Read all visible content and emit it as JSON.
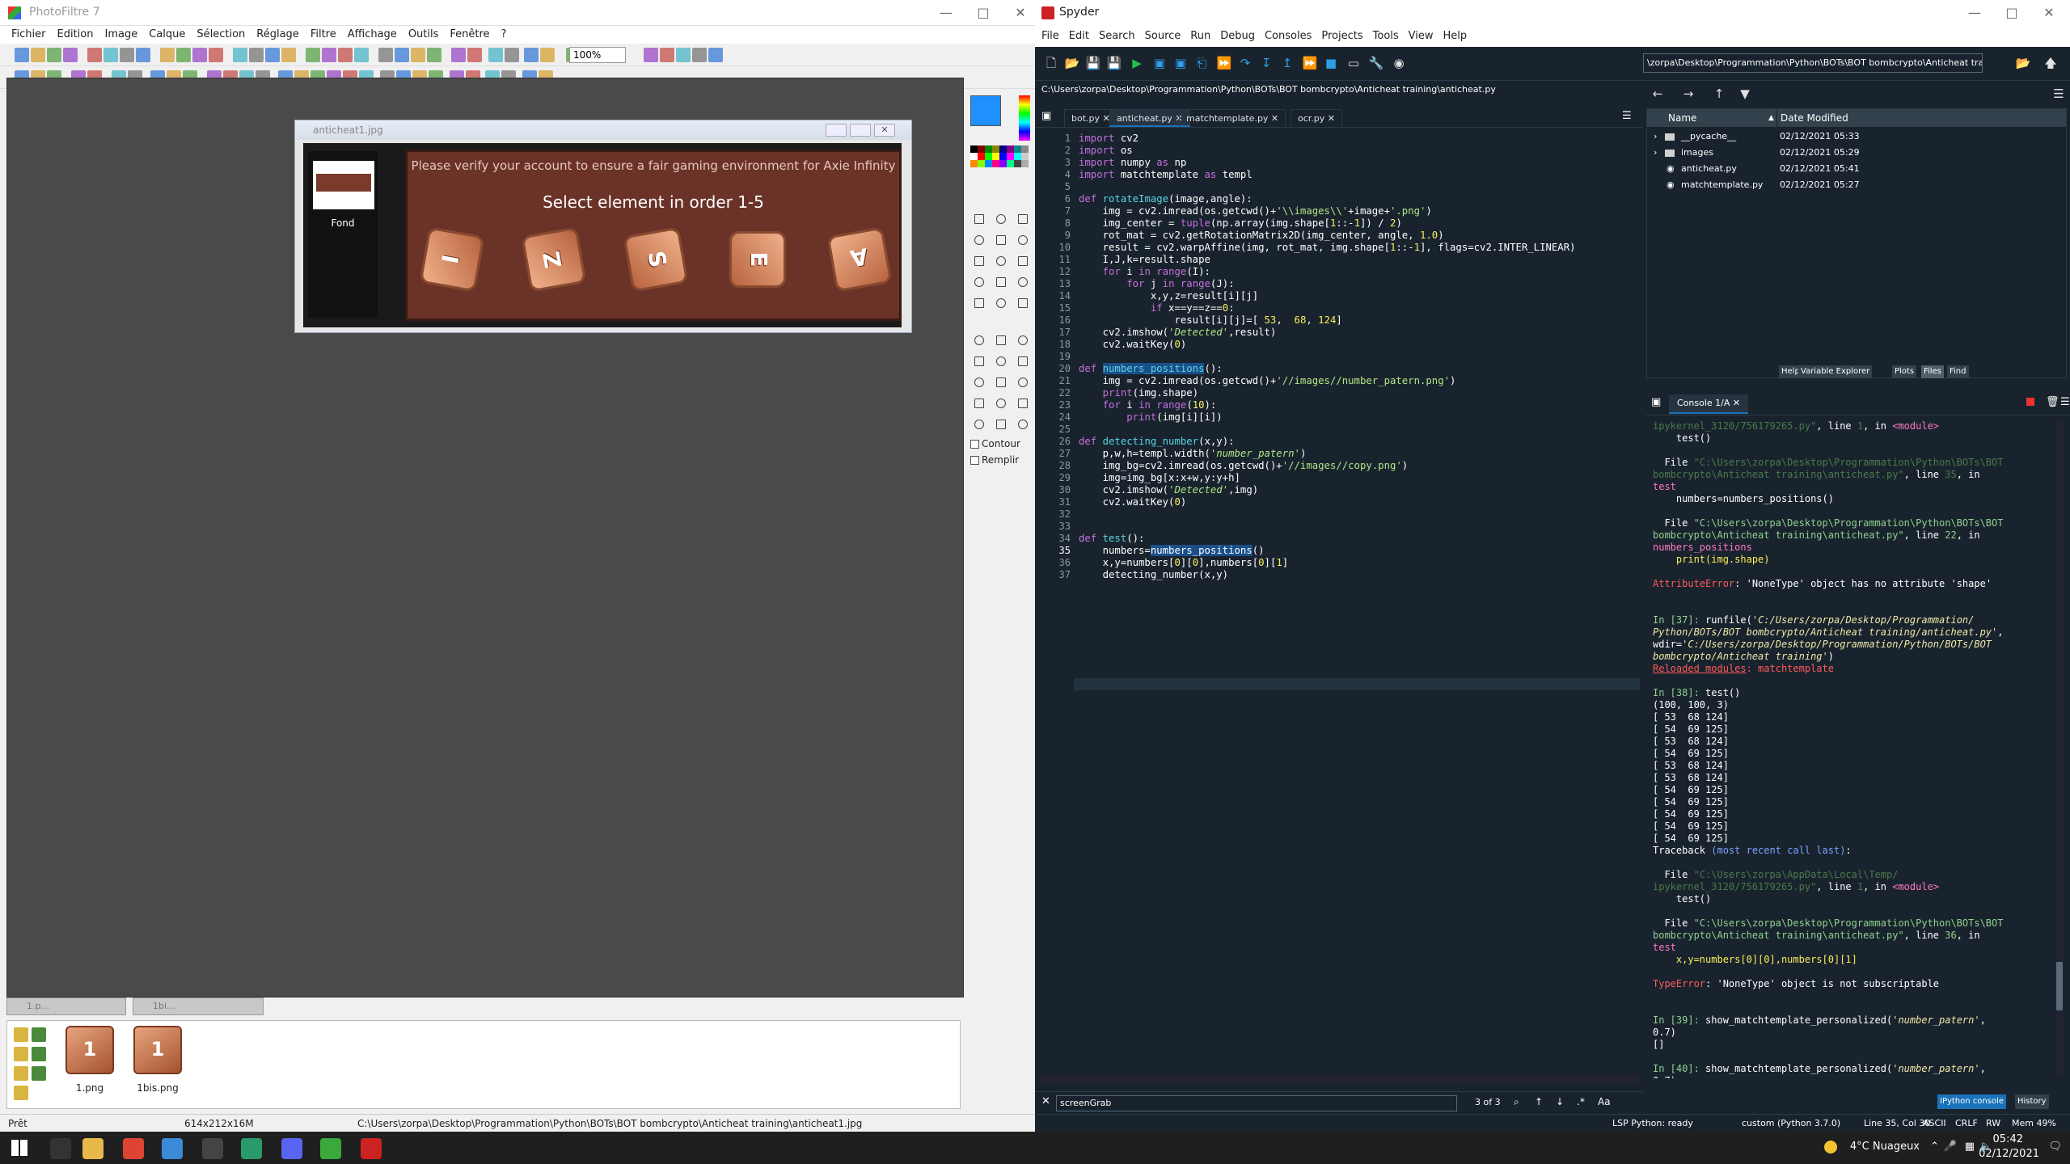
{
  "photofiltre": {
    "title": "PhotoFiltre 7",
    "menu": [
      "Fichier",
      "Edition",
      "Image",
      "Calque",
      "Sélection",
      "Réglage",
      "Filtre",
      "Affichage",
      "Outils",
      "Fenêtre",
      "?"
    ],
    "zoom": "100%",
    "image_window": {
      "title": "anticheat1.jpg",
      "layer_label": "Fond",
      "game_line1": "Please verify your account to ensure a fair gaming environment for Axie Infinity",
      "game_line2": "Select element in order 1-5",
      "tiles": [
        "I",
        "Z",
        "S",
        "E",
        "Ɐ"
      ]
    },
    "palette": {
      "contour": "Contour",
      "remplir": "Remplir"
    },
    "mini_windows": [
      "1.p...",
      "1bi..."
    ],
    "thumbs": [
      {
        "label": "1.png",
        "glyph": "1"
      },
      {
        "label": "1bis.png",
        "glyph": "1"
      }
    ],
    "status": {
      "ready": "Prêt",
      "size": "614x212x16M",
      "path": "C:\\Users\\zorpa\\Desktop\\Programmation\\Python\\BOTs\\BOT bombcrypto\\Anticheat training\\anticheat1.jpg"
    }
  },
  "spyder": {
    "title": "Spyder",
    "menu": [
      "File",
      "Edit",
      "Search",
      "Source",
      "Run",
      "Debug",
      "Consoles",
      "Projects",
      "Tools",
      "View",
      "Help"
    ],
    "workdir": "\\zorpa\\Desktop\\Programmation\\Python\\BOTs\\BOT bombcrypto\\Anticheat training",
    "file_path": "C:\\Users\\zorpa\\Desktop\\Programmation\\Python\\BOTs\\BOT bombcrypto\\Anticheat training\\anticheat.py",
    "tabs": [
      "bot.py",
      "anticheat.py",
      "matchtemplate.py",
      "ocr.py"
    ],
    "active_tab": "anticheat.py",
    "files": {
      "head_name": "Name",
      "head_date": "Date Modified",
      "rows": [
        {
          "name": "__pycache__",
          "date": "02/12/2021 05:33"
        },
        {
          "name": "images",
          "date": "02/12/2021 05:29"
        },
        {
          "name": "anticheat.py",
          "date": "02/12/2021 05:41"
        },
        {
          "name": "matchtemplate.py",
          "date": "02/12/2021 05:27"
        }
      ],
      "tabs": [
        "Help",
        "Variable Explorer",
        "Plots",
        "Files",
        "Find"
      ]
    },
    "console_tab": "Console 1/A",
    "console_bottom_tabs": [
      "IPython console",
      "History"
    ],
    "find": {
      "value": "screenGrab",
      "count": "3 of 3"
    },
    "status": {
      "lsp": "LSP Python: ready",
      "env": "custom (Python 3.7.0)",
      "pos": "Line 35, Col 30",
      "enc": "ASCII",
      "eol": "CRLF",
      "rw": "RW",
      "mem": "Mem 49%"
    }
  },
  "taskbar": {
    "weather": "4°C  Nuageux",
    "time": "05:42",
    "date": "02/12/2021"
  }
}
